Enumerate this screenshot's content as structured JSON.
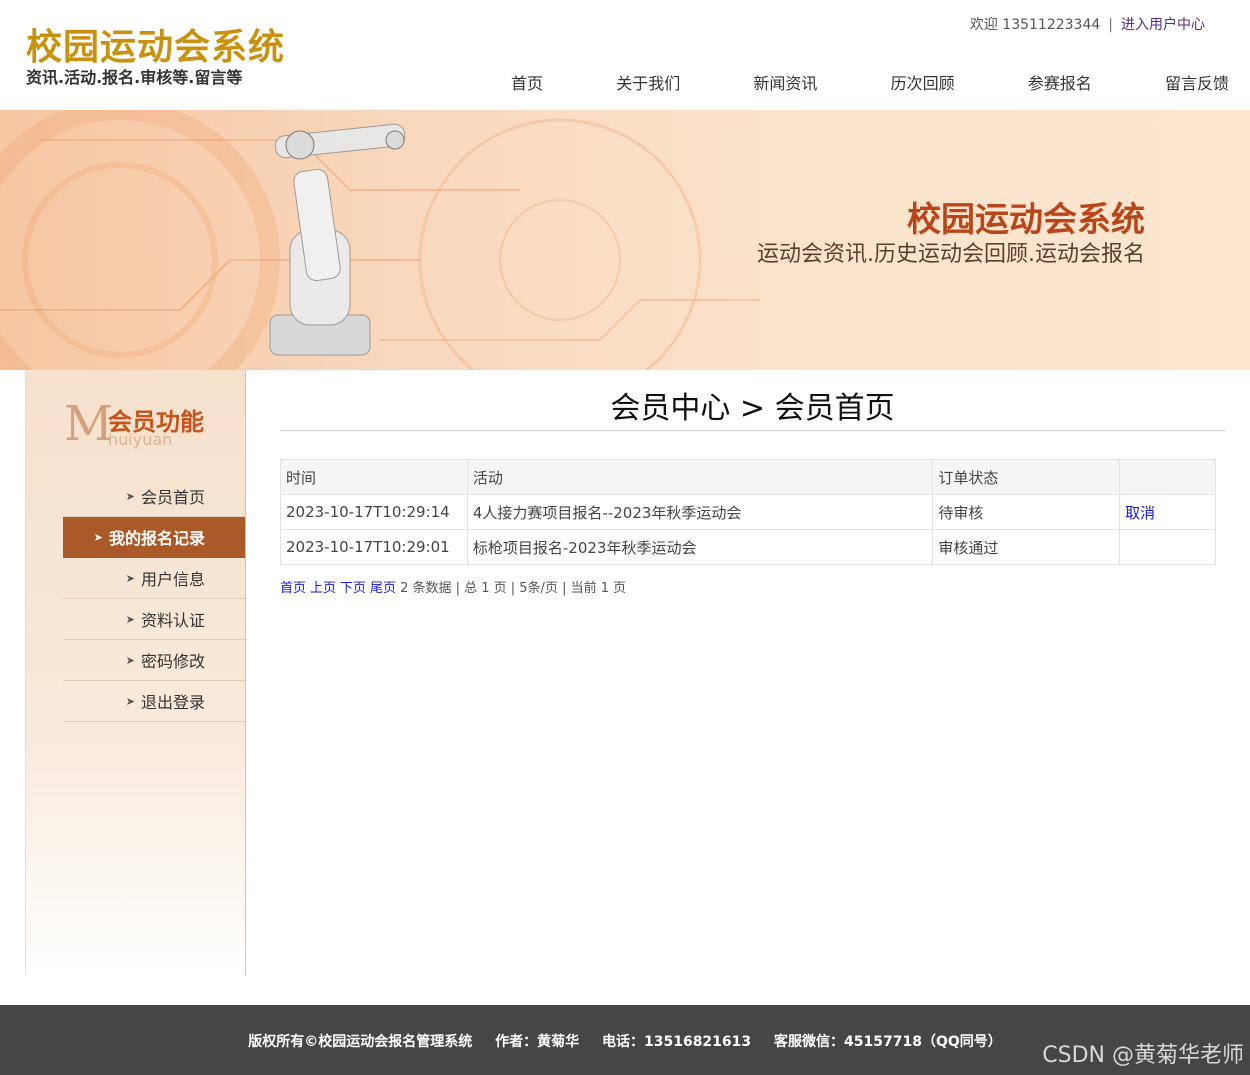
{
  "header": {
    "logo_title": "校园运动会系统",
    "logo_sub": "资讯.活动.报名.审核等.留言等",
    "welcome": "欢迎 13511223344",
    "separator": "|",
    "user_center": "进入用户中心"
  },
  "nav": [
    "首页",
    "关于我们",
    "新闻资讯",
    "历次回顾",
    "参赛报名",
    "留言反馈"
  ],
  "banner": {
    "title": "校园运动会系统",
    "subtitle": "运动会资讯.历史运动会回顾.运动会报名"
  },
  "sidebar": {
    "letter": "M",
    "title": "会员功能",
    "title_en": "huiyuan",
    "items": [
      "会员首页",
      "我的报名记录",
      "用户信息",
      "资料认证",
      "密码修改",
      "退出登录"
    ],
    "active_index": 1
  },
  "main": {
    "page_title": "会员中心 > 会员首页",
    "table": {
      "headers": [
        "时间",
        "活动",
        "订单状态",
        ""
      ],
      "rows": [
        {
          "time": "2023-10-17T10:29:14",
          "activity": "4人接力赛项目报名--2023年秋季运动会",
          "status": "待审核",
          "action": "取消"
        },
        {
          "time": "2023-10-17T10:29:01",
          "activity": "标枪项目报名-2023年秋季运动会",
          "status": "审核通过",
          "action": ""
        }
      ]
    },
    "pager": {
      "first": "首页",
      "prev": "上页",
      "next": "下页",
      "last": "尾页",
      "summary": "2 条数据 | 总 1 页 | 5条/页 | 当前 1 页"
    }
  },
  "footer": {
    "copyright": "版权所有©校园运动会报名管理系统",
    "author": "作者：黄菊华",
    "phone": "电话：13516821613",
    "wechat": "客服微信：45157718（QQ同号）",
    "watermark": "CSDN @黄菊华老师"
  },
  "colors": {
    "logo": "#c8920f",
    "banner_title": "#b8461a",
    "sidebar_active": "#a95a28",
    "status_pending": "#e0001b",
    "link": "#1a1ad2",
    "footer_bg": "#464646"
  }
}
